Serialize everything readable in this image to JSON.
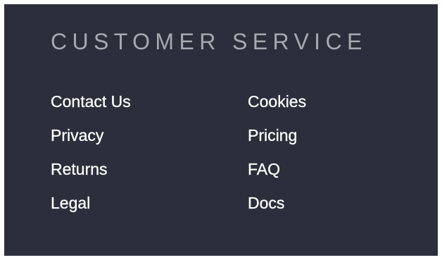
{
  "customer_service": {
    "title": "CUSTOMER SERVICE",
    "columns": [
      [
        "Contact Us",
        "Privacy",
        "Returns",
        "Legal"
      ],
      [
        "Cookies",
        "Pricing",
        "FAQ",
        "Docs"
      ]
    ]
  },
  "colors": {
    "panel_background": "#2c2f3b",
    "heading_text": "#a7a9b1",
    "link_text": "#ffffff",
    "page_background": "#ffffff"
  }
}
